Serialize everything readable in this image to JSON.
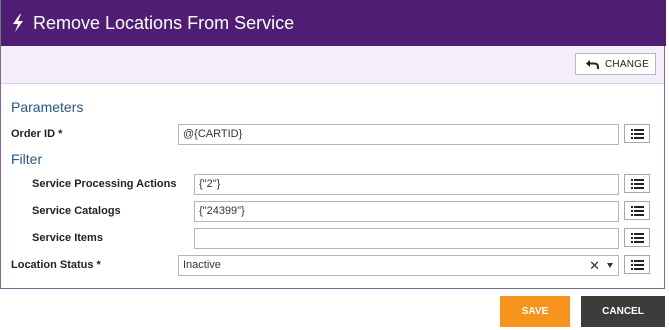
{
  "dialog": {
    "title": "Remove Locations From Service",
    "title_icon": "lightning-bolt-icon",
    "header_color": "#4f1e74"
  },
  "toolbar": {
    "change_label": "CHANGE",
    "change_icon": "undo-arrow-icon"
  },
  "parameters": {
    "heading": "Parameters",
    "order_id": {
      "label": "Order ID *",
      "value": "@{CARTID}"
    }
  },
  "filter": {
    "heading": "Filter",
    "service_processing_actions": {
      "label": "Service Processing Actions",
      "value": "{\"2\"}"
    },
    "service_catalogs": {
      "label": "Service Catalogs",
      "value": "{\"24399\"}"
    },
    "service_items": {
      "label": "Service Items",
      "value": ""
    }
  },
  "location_status": {
    "label": "Location Status *",
    "selected": "Inactive",
    "clear_symbol": "✕"
  },
  "footer": {
    "save_label": "SAVE",
    "cancel_label": "CANCEL",
    "save_color": "#f7941d",
    "cancel_color": "#3c3c3c"
  }
}
